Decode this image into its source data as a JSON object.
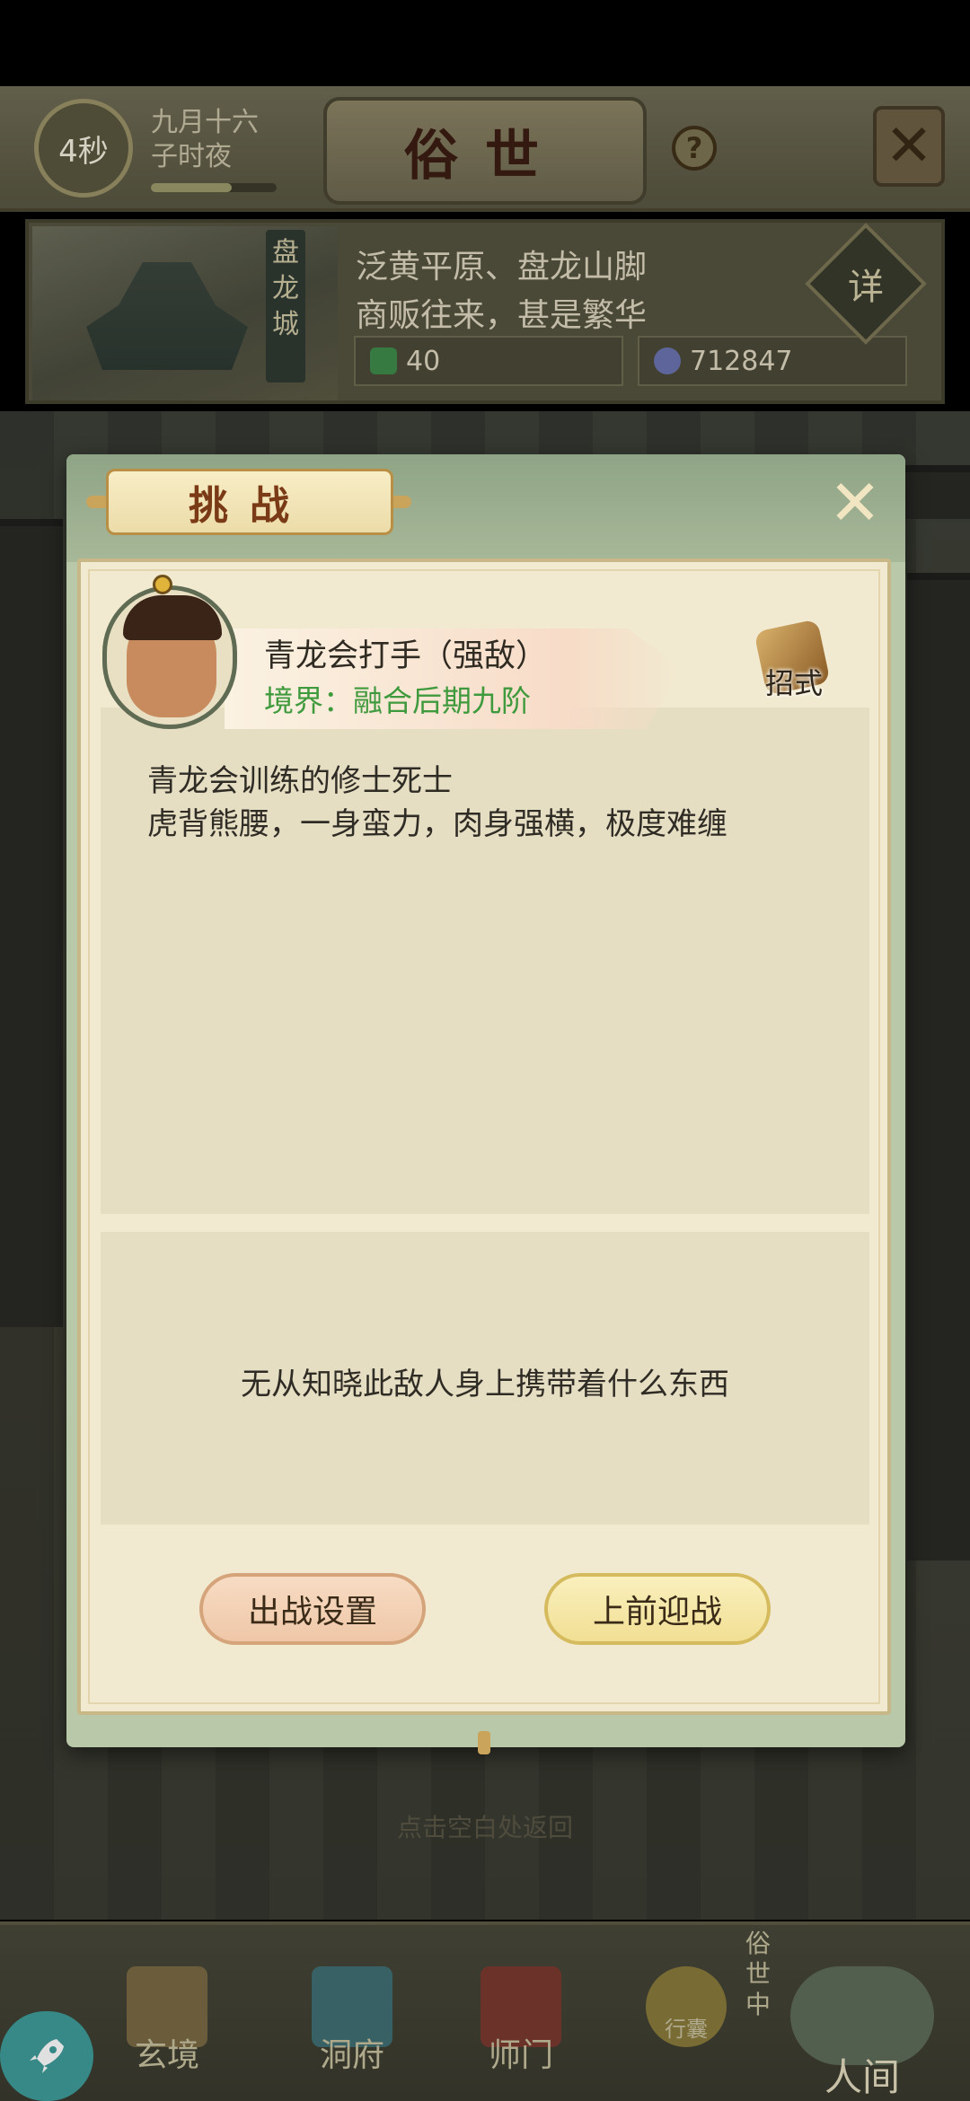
{
  "header": {
    "timer": "4秒",
    "date": "九月十六",
    "time_of_day": "子时夜",
    "title": "俗世",
    "help": "?"
  },
  "city": {
    "name": "盘龙城",
    "line1": "泛黄平原、盘龙山脚",
    "line2": "商贩往来，甚是繁华",
    "resource1": "40",
    "resource2": "712847",
    "detail": "详"
  },
  "background_hint": "点击空白处返回",
  "nav": {
    "items": [
      {
        "label": "玄境"
      },
      {
        "label": "洞府"
      },
      {
        "label": "师门"
      },
      {
        "label": "行囊"
      },
      {
        "label": "人间"
      }
    ],
    "world_badge": "俗世中"
  },
  "dialog": {
    "title": "挑战",
    "enemy": {
      "name": "青龙会打手（强敌）",
      "realm": "境界：融合后期九阶",
      "skill_label": "招式"
    },
    "description": [
      "青龙会训练的修士死士",
      "虎背熊腰，一身蛮力，肉身强横，极度难缠"
    ],
    "drops_text": "无从知晓此敌人身上携带着什么东西",
    "buttons": {
      "settings": "出战设置",
      "fight": "上前迎战"
    }
  },
  "colors": {
    "realm_green": "#3f9a3d",
    "title_brown": "#7b3a16",
    "settings_button": "#efc7a7",
    "fight_button": "#f1df94"
  }
}
